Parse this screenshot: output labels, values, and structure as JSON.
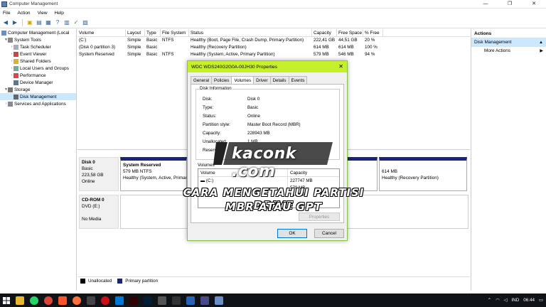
{
  "window": {
    "title": "Computer Management",
    "minimize": "—",
    "maximize": "❐",
    "close": "✕"
  },
  "menu": [
    "File",
    "Action",
    "View",
    "Help"
  ],
  "tree": [
    {
      "label": "Computer Management (Local",
      "level": 0,
      "icon": "computer-icon"
    },
    {
      "label": "System Tools",
      "level": 1,
      "icon": "tools-icon"
    },
    {
      "label": "Task Scheduler",
      "level": 2,
      "icon": "clock-icon"
    },
    {
      "label": "Event Viewer",
      "level": 2,
      "icon": "event-icon"
    },
    {
      "label": "Shared Folders",
      "level": 2,
      "icon": "folder-icon"
    },
    {
      "label": "Local Users and Groups",
      "level": 2,
      "icon": "users-icon"
    },
    {
      "label": "Performance",
      "level": 2,
      "icon": "performance-icon"
    },
    {
      "label": "Device Manager",
      "level": 2,
      "icon": "device-icon"
    },
    {
      "label": "Storage",
      "level": 1,
      "icon": "storage-icon"
    },
    {
      "label": "Disk Management",
      "level": 2,
      "icon": "disk-icon",
      "selected": true
    },
    {
      "label": "Services and Applications",
      "level": 1,
      "icon": "services-icon"
    }
  ],
  "volume_list": {
    "headers": [
      "Volume",
      "Layout",
      "Type",
      "File System",
      "Status",
      "Capacity",
      "Free Space",
      "% Free"
    ],
    "rows": [
      [
        "(C:)",
        "Simple",
        "Basic",
        "NTFS",
        "Healthy (Boot, Page File, Crash Dump, Primary Partition)",
        "222,41 GB",
        "44,51 GB",
        "20 %"
      ],
      [
        "(Disk 0 partition 3)",
        "Simple",
        "Basic",
        "",
        "Healthy (Recovery Partition)",
        "614 MB",
        "614 MB",
        "100 %"
      ],
      [
        "System Reserved",
        "Simple",
        "Basic",
        "NTFS",
        "Healthy (System, Active, Primary Partition)",
        "579 MB",
        "546 MB",
        "94 %"
      ]
    ]
  },
  "disk0": {
    "name": "Disk 0",
    "type": "Basic",
    "size": "223,58 GB",
    "status": "Online",
    "part1_name": "System Reserved",
    "part1_size": "579 MB NTFS",
    "part1_status": "Healthy (System, Active, Primar",
    "part3_size": "614 MB",
    "part3_status": "Healthy (Recovery Partition)"
  },
  "cdrom": {
    "name": "CD-ROM 0",
    "type": "DVD (E:)",
    "media": "No Media"
  },
  "legend": {
    "unallocated": "Unallocated",
    "primary": "Primary partition",
    "unallocated_color": "#000000",
    "primary_color": "#1a237e"
  },
  "actions": {
    "header": "Actions",
    "selected": "Disk Management",
    "more": "More Actions"
  },
  "dialog": {
    "title": "WDC WDS240G2G0A-00JH30 Properties",
    "close": "✕",
    "tabs": [
      "General",
      "Policies",
      "Volumes",
      "Driver",
      "Details",
      "Events"
    ],
    "active_tab": "Volumes",
    "group_title": "Disk Information",
    "info": [
      [
        "Disk:",
        "Disk 0"
      ],
      [
        "Type:",
        "Basic"
      ],
      [
        "Status:",
        "Online"
      ],
      [
        "Partition style:",
        "Master Boot Record (MBR)"
      ],
      [
        "Capacity:",
        "228943 MB"
      ],
      [
        "Unallocated",
        "1 MB"
      ],
      [
        "Reserved",
        ""
      ]
    ],
    "volumes_label": "Volumes",
    "vol_headers": [
      "Volume",
      "Capacity"
    ],
    "vol_rows": [
      [
        "(C:)",
        "227747 MB"
      ],
      [
        "",
        "579 MB"
      ],
      [
        "",
        "614 MB"
      ]
    ],
    "properties_btn": "Properties",
    "ok": "OK",
    "cancel": "Cancel",
    "title_color": "#c6ef2c"
  },
  "watermark": {
    "site": "kaconk .com",
    "line1": "CARA MENGETAHUI PARTISI DRIVE",
    "line2": "MBR ATAU GPT"
  },
  "taskbar": {
    "lang": "IND",
    "time": "06:44"
  }
}
